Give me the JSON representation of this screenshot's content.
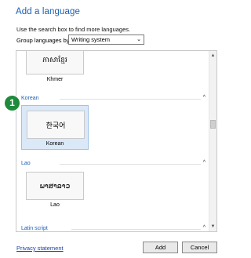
{
  "dialog": {
    "title": "Add a language",
    "hint": "Use the search box to find more languages."
  },
  "filter": {
    "label": "Group languages by:",
    "value": "Writing system",
    "chevron": "chevron-down-icon"
  },
  "list": {
    "sections": [
      {
        "name": "Khmer",
        "tiles": [
          {
            "script": "ភាសាខ្មែរ",
            "label": "Khmer"
          }
        ]
      },
      {
        "name": "Korean",
        "tiles": [
          {
            "script": "한국어",
            "label": "Korean",
            "selected": true
          }
        ]
      },
      {
        "name": "Lao",
        "tiles": [
          {
            "script": "ພາສາລາວ",
            "label": "Lao"
          }
        ]
      },
      {
        "name": "Latin script",
        "tiles": []
      }
    ],
    "collapse_icon": "chevron-up-icon"
  },
  "annotation": {
    "badge": "1"
  },
  "footer": {
    "privacy": "Privacy statement",
    "add": "Add",
    "cancel": "Cancel"
  },
  "colors": {
    "accent": "#1a5fb4",
    "selected_bg": "#dbe8f7",
    "badge": "#1f8a3b"
  }
}
